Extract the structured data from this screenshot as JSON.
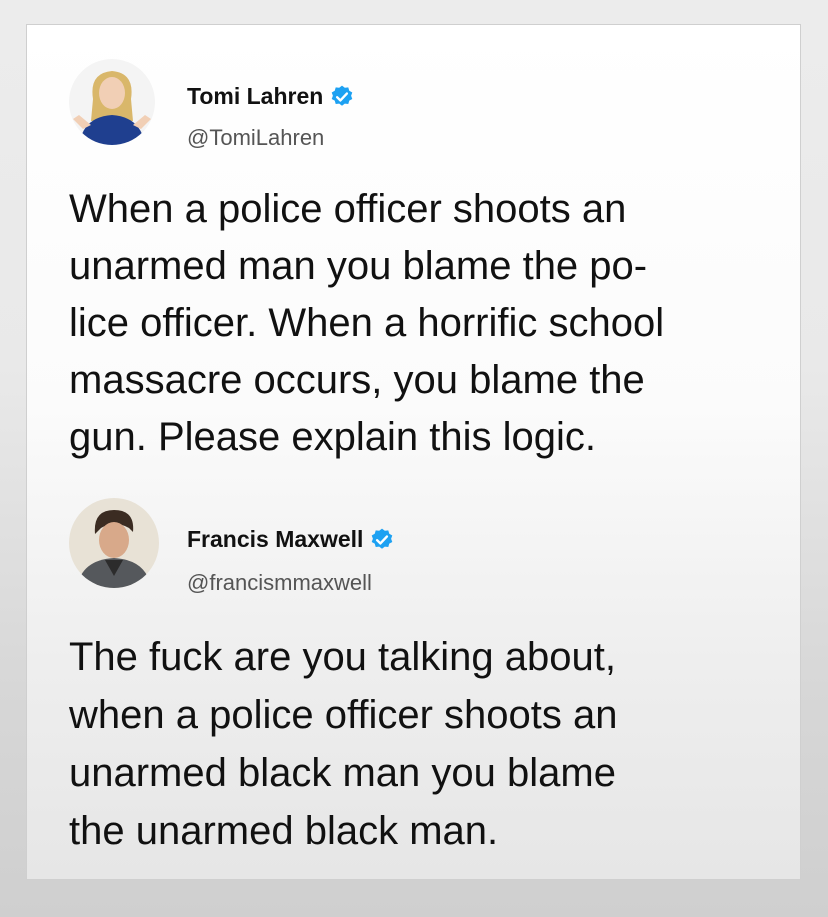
{
  "tweets": [
    {
      "name": "Tomi Lahren",
      "handle": "@TomiLahren",
      "verified": true,
      "avatar": "avatar-blonde-woman",
      "text_lines": [
        "When a police officer shoots an",
        "unarmed man you blame the po-",
        "lice officer. When a horrific school",
        "massacre occurs, you blame the",
        "gun. Please explain this logic."
      ]
    },
    {
      "name": "Francis Maxwell",
      "handle": "@francismmaxwell",
      "verified": true,
      "avatar": "avatar-man-jacket",
      "text_lines": [
        "The fuck are you talking about,",
        "when a police officer shoots an",
        "unarmed black man you blame",
        "the unarmed black man."
      ]
    }
  ],
  "colors": {
    "verified_badge": "#1da1f2",
    "text": "#111111",
    "handle": "#555555"
  }
}
